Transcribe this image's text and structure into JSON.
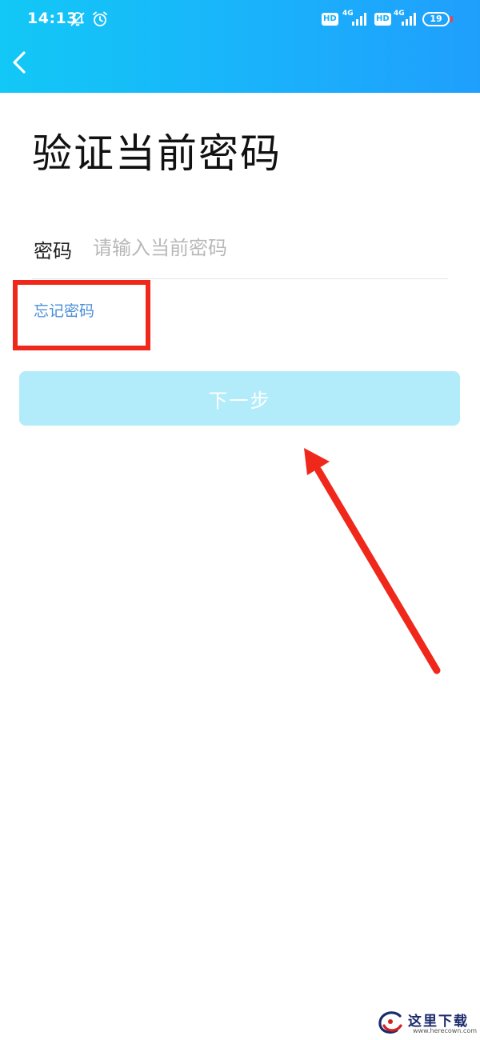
{
  "status_bar": {
    "time": "14:13",
    "icons": [
      "muted-bell-icon",
      "alarm-icon"
    ],
    "hd_label": "HD",
    "network_label": "4G",
    "battery_level": "19"
  },
  "nav": {
    "back_icon": "chevron-left-icon"
  },
  "page_title": "验证当前密码",
  "password_field": {
    "label": "密码",
    "placeholder": "请输入当前密码",
    "value": ""
  },
  "forgot_password_label": "忘记密码",
  "next_button_label": "下一步",
  "annotations": {
    "highlight_color": "#f0281c",
    "arrow_color": "#f0281c"
  },
  "watermark": {
    "name": "这里下载",
    "url": "www.herecown.com"
  },
  "colors": {
    "header_gradient_start": "#12c8f6",
    "header_gradient_end": "#1f9ffc",
    "link": "#4a8fd8",
    "button_disabled": "#b2ecfa"
  }
}
